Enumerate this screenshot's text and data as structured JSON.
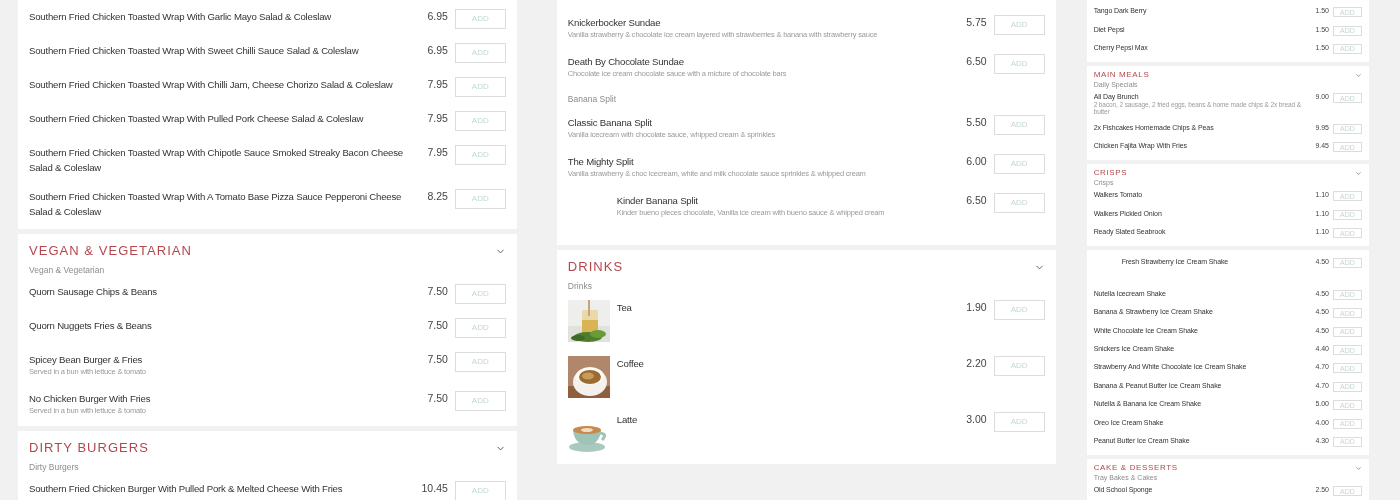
{
  "columns": [
    {
      "panels": [
        {
          "items": [
            {
              "kind": "item",
              "name": "Southern Fried Chicken Toasted Wrap With Garlic Mayo Salad & Coleslaw",
              "price": "6.95",
              "button": "ADD"
            },
            {
              "kind": "item",
              "name": "Southern Fried Chicken Toasted Wrap With Sweet Chilli Sauce Salad & Coleslaw",
              "price": "6.95",
              "button": "ADD"
            },
            {
              "kind": "item",
              "name": "Southern Fried Chicken Toasted Wrap With Chilli Jam, Cheese Chorizo Salad & Coleslaw",
              "price": "7.95",
              "button": "ADD"
            },
            {
              "kind": "item",
              "name": "Southern Fried Chicken Toasted Wrap With Pulled Pork Cheese Salad & Coleslaw",
              "price": "7.95",
              "button": "ADD"
            },
            {
              "kind": "item",
              "name": "Southern Fried Chicken Toasted Wrap With Chipotle Sauce Smoked Streaky Bacon Cheese Salad & Coleslaw",
              "price": "7.95",
              "button": "ADD"
            },
            {
              "kind": "item",
              "name": "Southern Fried Chicken Toasted Wrap With A Tomato Base Pizza Sauce Pepperoni Cheese Salad & Coleslaw",
              "price": "8.25",
              "button": "ADD"
            }
          ]
        },
        {
          "title": "VEGAN & VEGETARIAN",
          "subtitle": "Vegan & Vegetarian",
          "items": [
            {
              "kind": "item",
              "name": "Quorn Sausage Chips & Beans",
              "price": "7.50",
              "button": "ADD"
            },
            {
              "kind": "item",
              "name": "Quorn Nuggets Fries & Beans",
              "price": "7.50",
              "button": "ADD"
            },
            {
              "kind": "item",
              "name": "Spicey Bean Burger & Fries",
              "description": "Served in a bun with lettuce & tomato",
              "price": "7.50",
              "button": "ADD"
            },
            {
              "kind": "item",
              "name": "No Chicken Burger With Fries",
              "description": "Served in a bun with lettuce & tomato",
              "price": "7.50",
              "button": "ADD"
            }
          ]
        },
        {
          "title": "DIRTY BURGERS",
          "subtitle": "Dirty Burgers",
          "items": [
            {
              "kind": "item",
              "name": "Southern Fried Chicken Burger With Pulled Pork & Melted Cheese With Fries",
              "price": "10.45",
              "button": "ADD"
            }
          ]
        }
      ]
    },
    {
      "panels": [
        {
          "items": [
            {
              "kind": "item",
              "name": "Knickerbocker Sundae",
              "description": "Vanilla strawberry & chocolate ice cream layered with strawberries & banana with strawberry sauce",
              "price": "5.75",
              "button": "ADD"
            },
            {
              "kind": "item",
              "name": "Death By Chocolate Sundae",
              "description": "Chocolate ice cream chocolate sauce with a micture of chocolate bars",
              "price": "6.50",
              "button": "ADD"
            },
            {
              "kind": "subheading",
              "text": "Banana Split"
            },
            {
              "kind": "item",
              "name": "Classic Banana Split",
              "description": "Vanilla icecream with chocolate sauce, whipped cream & sprinkles",
              "price": "5.50",
              "button": "ADD"
            },
            {
              "kind": "item",
              "name": "The Mighty Split",
              "description": "Vanilla strawberry & choc icecream, white and milk chocolate sauce sprinkles & whipped cream",
              "price": "6.00",
              "button": "ADD"
            },
            {
              "kind": "spaced",
              "name": "Kinder Banana Split",
              "description": "Kinder bueno pieces chocolate, Vanilla ice cream with bueno sauce & whipped cream",
              "price": "6.50",
              "button": "ADD"
            }
          ]
        },
        {
          "title": "DRINKS",
          "subtitle": "Drinks",
          "items": [
            {
              "name": "Tea",
              "price": "1.90",
              "button": "ADD"
            },
            {
              "name": "Coffee",
              "price": "2.20",
              "button": "ADD"
            },
            {
              "name": "Latte",
              "price": "3.00",
              "button": "ADD"
            }
          ]
        }
      ]
    },
    {
      "panels": [
        {
          "items": [
            {
              "kind": "item",
              "name": "Tango Dark Berry",
              "price": "1.50",
              "button": "ADD"
            },
            {
              "kind": "item",
              "name": "Diet Pepsi",
              "price": "1.50",
              "button": "ADD"
            },
            {
              "kind": "item",
              "name": "Cherry Pepsi Max",
              "price": "1.50",
              "button": "ADD"
            }
          ]
        },
        {
          "title": "MAIN MEALS",
          "subtitle": "Daily Specials",
          "items": [
            {
              "kind": "item",
              "name": "All Day Brunch",
              "description": "2 bacon, 2 sausage, 2 fried eggs, beans & home made chips & 2x bread & butter",
              "price": "9.00",
              "button": "ADD"
            },
            {
              "kind": "item",
              "name": "2x Fishcakes Homemade Chips & Peas",
              "price": "9.95",
              "button": "ADD"
            },
            {
              "kind": "item",
              "name": "Chicken Fajita Wrap With Fries",
              "price": "9.45",
              "button": "ADD"
            }
          ]
        },
        {
          "title": "CRISPS",
          "subtitle": "Crisps",
          "items": [
            {
              "kind": "item",
              "name": "Walkers Tomato",
              "price": "1.10",
              "button": "ADD"
            },
            {
              "kind": "item",
              "name": "Walkers Pickled Onion",
              "price": "1.10",
              "button": "ADD"
            },
            {
              "kind": "item",
              "name": "Ready Slated Seabrook",
              "price": "1.10",
              "button": "ADD"
            }
          ]
        },
        {
          "items": [
            {
              "kind": "spaced",
              "name": "Fresh Strawberry Ice Cream Shake",
              "price": "4.50",
              "button": "ADD"
            },
            {
              "kind": "item",
              "name": "Nutella Icecream Shake",
              "price": "4.50",
              "button": "ADD"
            },
            {
              "kind": "item",
              "name": "Banana & Strawberry Ice Cream Shake",
              "price": "4.50",
              "button": "ADD"
            },
            {
              "kind": "item",
              "name": "White Chocolate Ice Cream Shake",
              "price": "4.50",
              "button": "ADD"
            },
            {
              "kind": "item",
              "name": "Snickers Ice Cream Shake",
              "price": "4.40",
              "button": "ADD"
            },
            {
              "kind": "item",
              "name": "Strawberry And White Chocolate Ice Cream Shake",
              "price": "4.70",
              "button": "ADD"
            },
            {
              "kind": "item",
              "name": "Banana & Peanut Butter Ice Cream Shake",
              "price": "4.70",
              "button": "ADD"
            },
            {
              "kind": "item",
              "name": "Nutella & Banana Ice Cream Shake",
              "price": "5.00",
              "button": "ADD"
            },
            {
              "kind": "item",
              "name": "Oreo Ice Cream Shake",
              "price": "4.00",
              "button": "ADD"
            },
            {
              "kind": "item",
              "name": "Peanut Butter Ice Cream Shake",
              "price": "4.30",
              "button": "ADD"
            }
          ]
        },
        {
          "title": "CAKE & DESSERTS",
          "subtitle": "Tray Bakes & Cakes",
          "items": [
            {
              "kind": "item",
              "name": "Old School Sponge",
              "price": "2.50",
              "button": "ADD"
            }
          ]
        }
      ]
    }
  ]
}
